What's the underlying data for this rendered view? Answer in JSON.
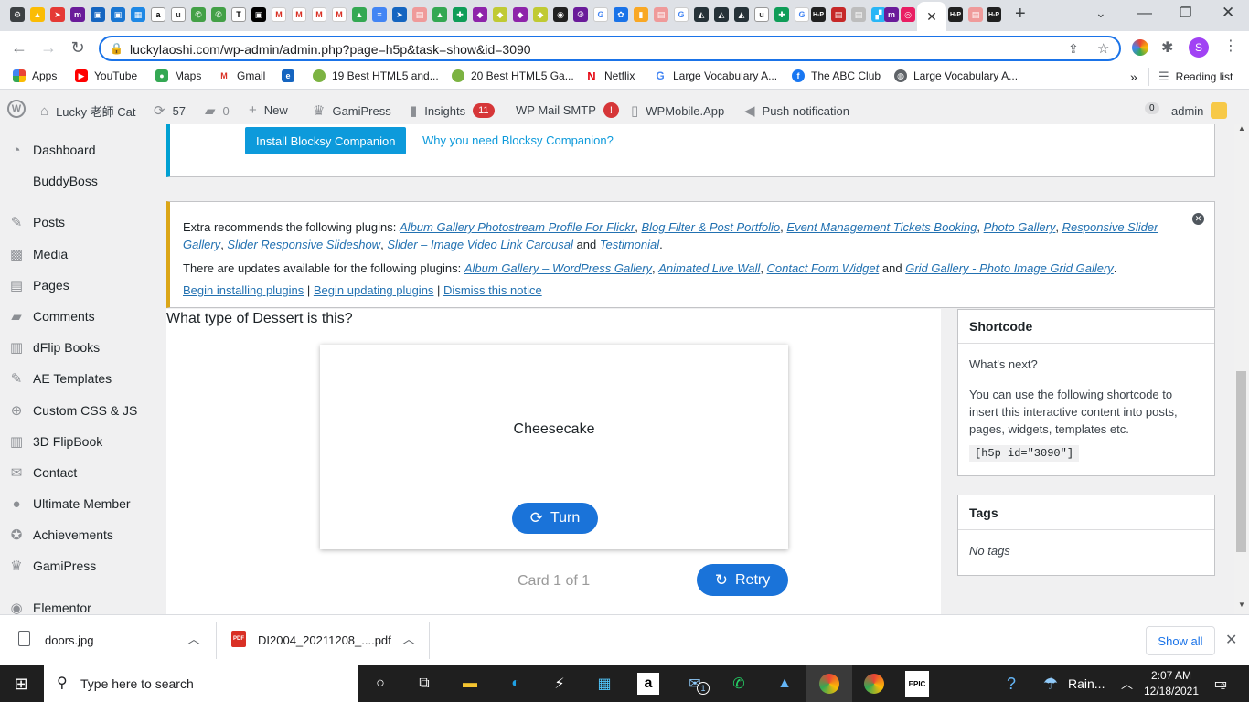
{
  "browser": {
    "url": "luckylaoshi.com/wp-admin/admin.php?page=h5p&task=show&id=3090",
    "profile_initial": "S",
    "bookmarks": [
      {
        "label": "Apps",
        "icon": "apps-grid-icon"
      },
      {
        "label": "YouTube",
        "icon": "youtube-icon"
      },
      {
        "label": "Maps",
        "icon": "maps-pin-icon"
      },
      {
        "label": "Gmail",
        "icon": "gmail-icon"
      },
      {
        "label": "",
        "icon": "ea-icon"
      },
      {
        "label": "19 Best HTML5 and...",
        "icon": "leaf-icon"
      },
      {
        "label": "20 Best HTML5 Ga...",
        "icon": "leaf-icon"
      },
      {
        "label": "Netflix",
        "icon": "netflix-icon"
      },
      {
        "label": "Large Vocabulary A...",
        "icon": "google-icon"
      },
      {
        "label": "The ABC Club",
        "icon": "facebook-icon"
      },
      {
        "label": "Large Vocabulary A...",
        "icon": "globe-icon"
      }
    ],
    "more_bookmarks": "»",
    "reading_list": "Reading list"
  },
  "adminbar": {
    "site_name": "Lucky 老師 Cat",
    "updates_count": "57",
    "comments_count": "0",
    "new_label": "New",
    "gamipress": "GamiPress",
    "insights": "Insights",
    "insights_badge": "11",
    "wp_mail_smtp": "WP Mail SMTP",
    "wp_mail_badge": "!",
    "wpmobile": "WPMobile.App",
    "push": "Push notification",
    "user_count": "0",
    "user": "admin"
  },
  "sidebar": {
    "items": [
      {
        "label": "Dashboard",
        "icon": "dashboard-icon"
      },
      {
        "label": "BuddyBoss",
        "icon": "buddyboss-icon"
      },
      {
        "label": "Posts",
        "icon": "pin-icon"
      },
      {
        "label": "Media",
        "icon": "media-icon"
      },
      {
        "label": "Pages",
        "icon": "pages-icon"
      },
      {
        "label": "Comments",
        "icon": "comment-icon"
      },
      {
        "label": "dFlip Books",
        "icon": "book-icon"
      },
      {
        "label": "AE Templates",
        "icon": "pin-icon"
      },
      {
        "label": "Custom CSS & JS",
        "icon": "plus-circle-icon"
      },
      {
        "label": "3D FlipBook",
        "icon": "book-icon"
      },
      {
        "label": "Contact",
        "icon": "mail-icon"
      },
      {
        "label": "Ultimate Member",
        "icon": "user-icon"
      },
      {
        "label": "Achievements",
        "icon": "award-icon"
      },
      {
        "label": "GamiPress",
        "icon": "crown-icon"
      },
      {
        "label": "Elementor",
        "icon": "elementor-icon"
      }
    ]
  },
  "blocksy": {
    "install_button": "Install Blocksy Companion",
    "why_link": "Why you need Blocksy Companion?"
  },
  "plugin_notice": {
    "line1_prefix": "Extra recommends the following plugins: ",
    "recommended": [
      "Album Gallery Photostream Profile For Flickr",
      "Blog Filter & Post Portfolio",
      "Event Management Tickets Booking",
      "Photo Gallery",
      "Responsive Slider Gallery",
      "Slider Responsive Slideshow",
      "Slider – Image Video Link Carousal"
    ],
    "recommended_last": "Testimonial",
    "line2_prefix": "There are updates available for the following plugins: ",
    "updates": [
      "Album Gallery – WordPress Gallery",
      "Animated Live Wall",
      "Contact Form Widget"
    ],
    "updates_last": "Grid Gallery - Photo Image Grid Gallery",
    "and_word": "and",
    "begin_installing": "Begin installing plugins",
    "begin_updating": "Begin updating plugins",
    "dismiss": "Dismiss this notice"
  },
  "flashcard": {
    "question": "What type of Dessert is this?",
    "answer": "Cheesecake",
    "turn_label": "Turn",
    "progress": "Card 1 of 1",
    "retry_label": "Retry"
  },
  "shortcode_box": {
    "title": "Shortcode",
    "whats_next": "What's next?",
    "description": "You can use the following shortcode to insert this interactive content into posts, pages, widgets, templates etc.",
    "code": "[h5p id=\"3090\"]"
  },
  "tags_box": {
    "title": "Tags",
    "empty": "No tags"
  },
  "downloads": {
    "items": [
      {
        "name": "doors.jpg"
      },
      {
        "name": "DI2004_20211208_....pdf"
      }
    ],
    "show_all": "Show all"
  },
  "taskbar": {
    "search_placeholder": "Type here to search",
    "weather": "Rain...",
    "time": "2:07 AM",
    "date": "12/18/2021",
    "mail_badge": "1",
    "notif_count": "2"
  }
}
